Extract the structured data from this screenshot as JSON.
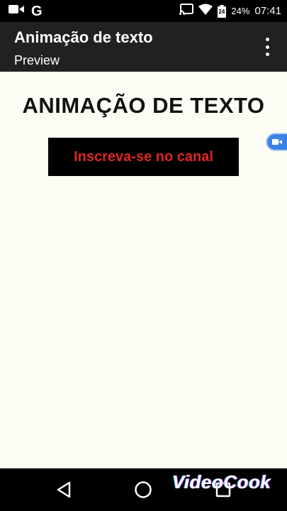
{
  "status_bar": {
    "g_letter": "G",
    "battery_level": "24",
    "battery_percent": "24%",
    "time": "07:41"
  },
  "app_bar": {
    "title": "Animação de texto",
    "subtitle": "Preview"
  },
  "content": {
    "heading": "ANIMAÇÃO DE TEXTO",
    "subscribe_text": "Inscreva-se no canal",
    "subscribe_color": "#e02424"
  },
  "watermark": {
    "text": "VideoCook"
  },
  "icons": {
    "status": [
      "video-camera-icon",
      "google-icon",
      "cast-icon",
      "wifi-icon",
      "battery-icon"
    ],
    "app_bar": [
      "overflow-menu-icon"
    ],
    "side": [
      "video-bubble-icon"
    ],
    "nav": [
      "back-icon",
      "home-icon",
      "recents-icon"
    ]
  },
  "colors": {
    "app_bar": "#212121",
    "content_bg": "#fdfcf4",
    "side_bubble": "#3b82e6"
  }
}
